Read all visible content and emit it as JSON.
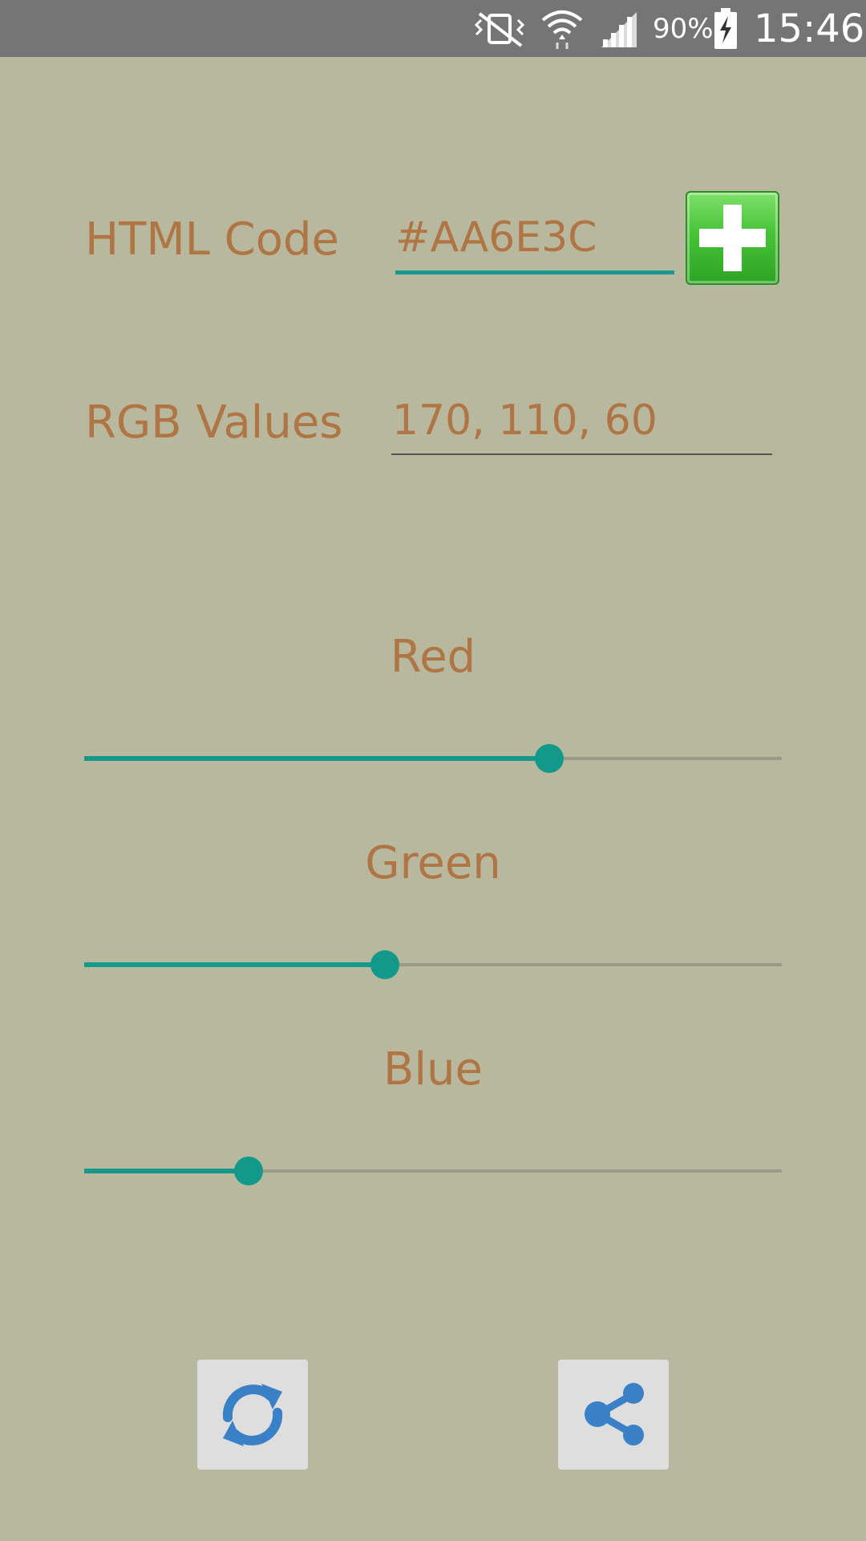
{
  "status_bar": {
    "battery_percent": "90%",
    "time": "15:46",
    "icons": [
      "mute-vibrate-icon",
      "wifi-icon",
      "signal-icon",
      "battery-charging-icon"
    ]
  },
  "form": {
    "html_code": {
      "label": "HTML Code",
      "value": "#AA6E3C"
    },
    "rgb_values": {
      "label": "RGB Values",
      "value": "170, 110, 60"
    },
    "add_icon": "plus-icon"
  },
  "sliders": [
    {
      "label": "Red",
      "value": 170,
      "max": 255
    },
    {
      "label": "Green",
      "value": 110,
      "max": 255
    },
    {
      "label": "Blue",
      "value": 60,
      "max": 255
    }
  ],
  "actions": {
    "refresh_icon": "refresh-icon",
    "share_icon": "share-icon"
  },
  "colors": {
    "background": "#b8b89e",
    "accent": "#16998a",
    "text": "#b07544",
    "action_icon": "#3a80c7"
  }
}
